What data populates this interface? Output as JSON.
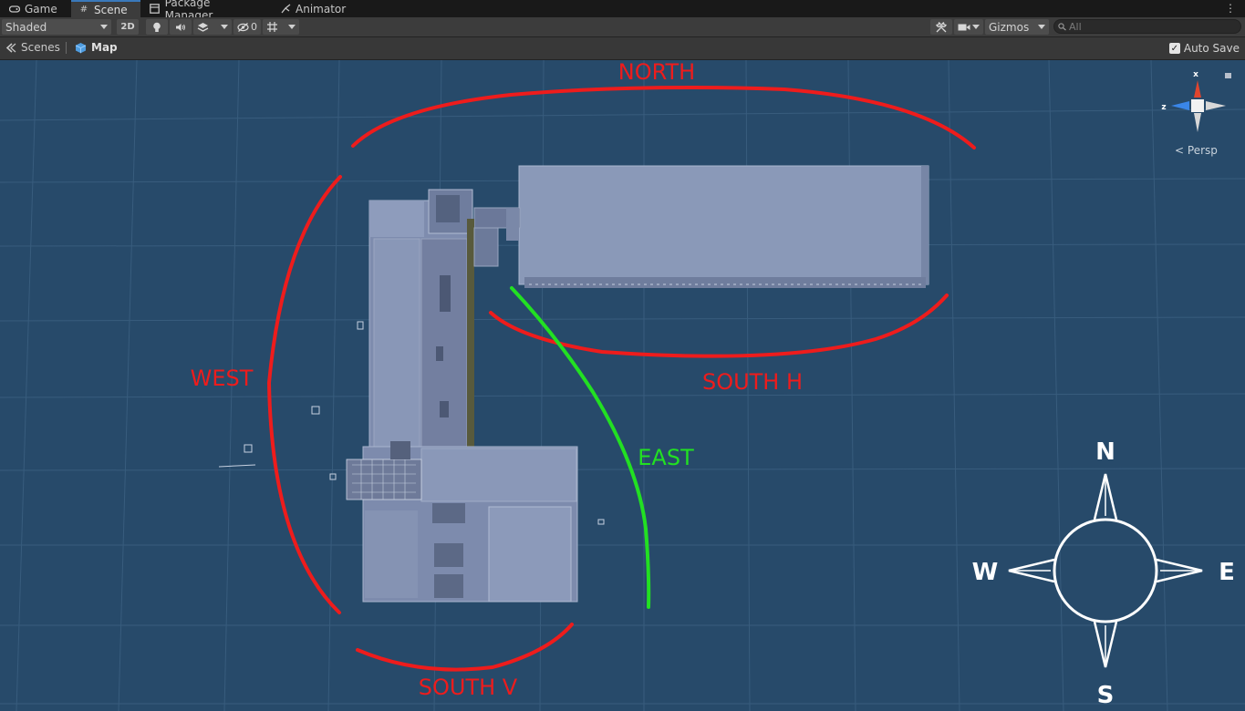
{
  "tabs": [
    {
      "label": "Game",
      "icon": "gamepad-icon"
    },
    {
      "label": "Scene",
      "icon": "grid-icon"
    },
    {
      "label": "Package Manager",
      "icon": "package-icon"
    },
    {
      "label": "Animator",
      "icon": "animator-icon"
    }
  ],
  "toolbar": {
    "shading_mode": "Shaded",
    "mode_2d": "2D",
    "hidden_count": "0",
    "gizmos": "Gizmos",
    "search_placeholder": "All"
  },
  "breadcrumb": {
    "root": "Scenes",
    "current": "Map",
    "auto_save": "Auto Save"
  },
  "orientation_gizmo": {
    "x_label": "x",
    "z_label": "z",
    "projection": "Persp"
  },
  "annotations": {
    "north": "NORTH",
    "west": "WEST",
    "east": "EAST",
    "south_h": "SOUTH H",
    "south_v": "SOUTH V"
  },
  "compass": {
    "n": "N",
    "e": "E",
    "s": "S",
    "w": "W"
  },
  "colors": {
    "accent": "#3a79bb",
    "viewport_bg": "#274a6a",
    "annotation_red": "#ee1c1c",
    "annotation_green": "#22e022",
    "building": "#8090b0"
  }
}
